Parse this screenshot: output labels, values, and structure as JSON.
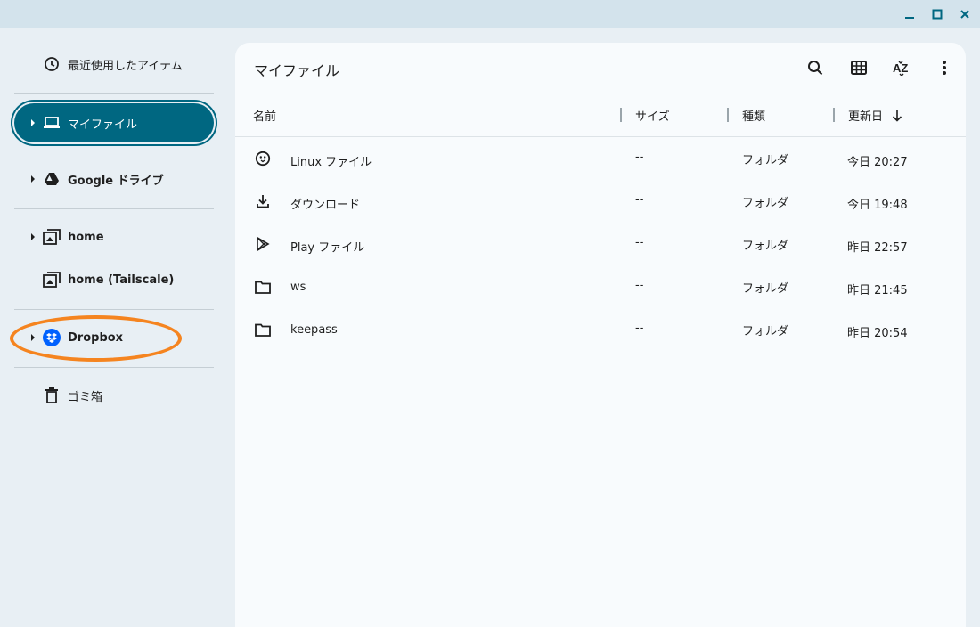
{
  "window": {
    "controls": [
      "minimize-icon",
      "maximize-icon",
      "close-icon"
    ],
    "accent": "#006781"
  },
  "sidebar": {
    "items": [
      {
        "label": "最近使用したアイテム",
        "icon": "clock-icon"
      },
      {
        "label": "マイファイル",
        "icon": "laptop-icon",
        "selected": true
      },
      {
        "label": "Google ドライブ",
        "icon": "google-drive-icon"
      },
      {
        "label": "home",
        "icon": "network-folder-icon"
      },
      {
        "label": "home (Tailscale)",
        "icon": "network-folder-icon"
      },
      {
        "label": "Dropbox",
        "icon": "dropbox-icon",
        "highlighted": true
      },
      {
        "label": "ゴミ箱",
        "icon": "trash-icon"
      }
    ]
  },
  "main": {
    "title": "マイファイル",
    "toolbar": [
      "search-icon",
      "grid-view-icon",
      "sort-az-icon",
      "more-vert-icon"
    ],
    "columns": {
      "name": "名前",
      "size": "サイズ",
      "type": "種類",
      "modified": "更新日"
    },
    "sort": {
      "column": "modified",
      "direction": "descending"
    },
    "files": [
      {
        "name": "Linux ファイル",
        "size": "--",
        "type": "フォルダ",
        "modified": "今日 20:27",
        "icon": "linux-icon"
      },
      {
        "name": "ダウンロード",
        "size": "--",
        "type": "フォルダ",
        "modified": "今日 19:48",
        "icon": "download-icon"
      },
      {
        "name": "Play ファイル",
        "size": "--",
        "type": "フォルダ",
        "modified": "昨日 22:57",
        "icon": "play-store-icon"
      },
      {
        "name": "ws",
        "size": "--",
        "type": "フォルダ",
        "modified": "昨日 21:45",
        "icon": "folder-icon"
      },
      {
        "name": "keepass",
        "size": "--",
        "type": "フォルダ",
        "modified": "昨日 20:54",
        "icon": "folder-icon"
      }
    ]
  }
}
